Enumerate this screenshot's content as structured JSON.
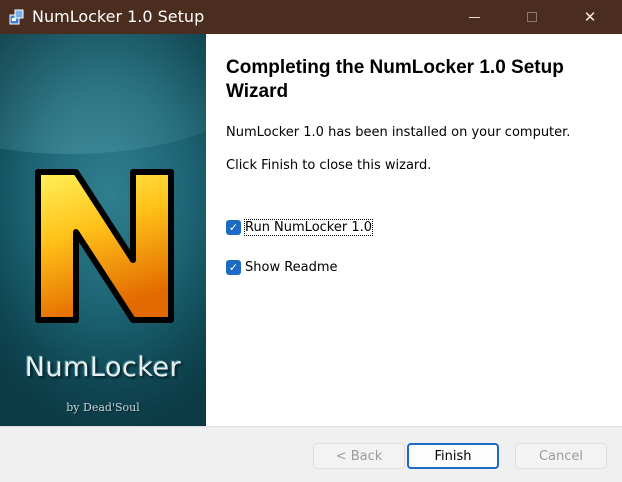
{
  "window": {
    "title": "NumLocker 1.0 Setup",
    "icon": "installer-icon",
    "controls": {
      "minimize": "minimize-icon",
      "maximize": "maximize-icon",
      "close": "✕"
    }
  },
  "banner": {
    "logo_letter": "N",
    "brand_name": "NumLocker",
    "byline": "by Dead'Soul",
    "colors": {
      "background": "#1e6675",
      "letter_fill": "#f6a400",
      "letter_outline": "#000000"
    }
  },
  "main": {
    "heading": "Completing the NumLocker 1.0 Setup Wizard",
    "installed_text": "NumLocker 1.0 has been installed on your computer.",
    "finish_hint": "Click Finish to close this wizard.",
    "options": [
      {
        "label": "Run NumLocker 1.0",
        "checked": true,
        "check_mark": "✓"
      },
      {
        "label": "Show Readme",
        "checked": true,
        "check_mark": "✓"
      }
    ]
  },
  "footer": {
    "back_label": "< Back",
    "finish_label": "Finish",
    "cancel_label": "Cancel",
    "accent": "#1f6ac2"
  }
}
